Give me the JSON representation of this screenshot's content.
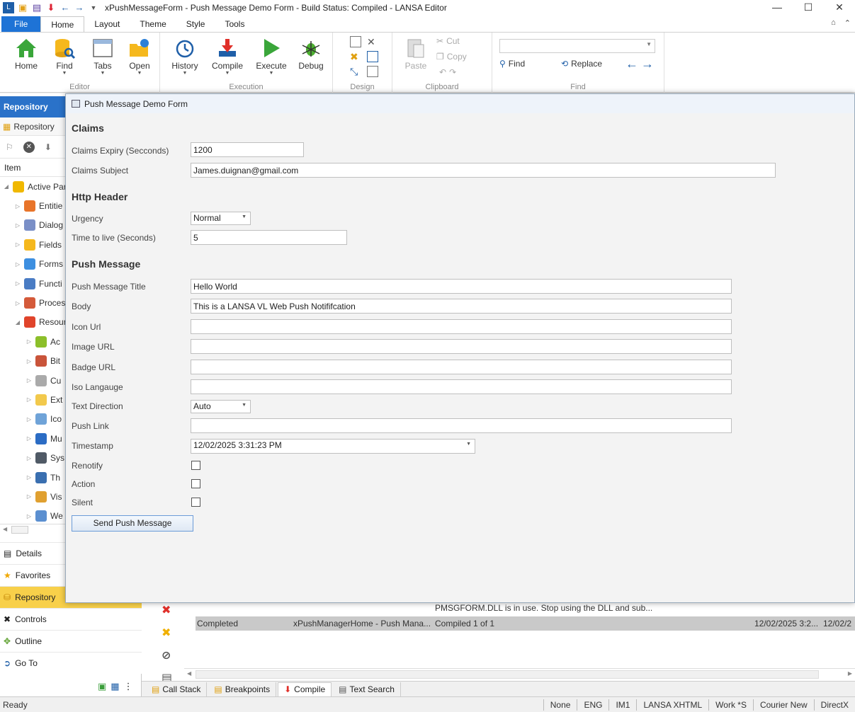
{
  "window": {
    "title": "xPushMessageForm - Push Message Demo Form -   Build Status: Compiled - LANSA Editor",
    "minimize": "—",
    "maximize": "☐",
    "close": "✕"
  },
  "ribbon_tabs": [
    "File",
    "Home",
    "Layout",
    "Theme",
    "Style",
    "Tools"
  ],
  "ribbon": {
    "editor": {
      "label": "Editor",
      "home": "Home",
      "find": "Find",
      "tabs": "Tabs",
      "open": "Open"
    },
    "execution": {
      "label": "Execution",
      "history": "History",
      "compile": "Compile",
      "execute": "Execute",
      "debug": "Debug"
    },
    "design": {
      "label": "Design"
    },
    "clipboard": {
      "label": "Clipboard",
      "paste": "Paste",
      "cut": "Cut",
      "copy": "Copy"
    },
    "find": {
      "label": "Find",
      "find": "Find",
      "replace": "Replace"
    }
  },
  "left_panel": {
    "header": "Repository",
    "tab": "Repository",
    "column": "Item",
    "tree": [
      {
        "label": "Active Par",
        "color": "#f0b800",
        "arrow": "◢",
        "indent": 0
      },
      {
        "label": "Entitie",
        "color": "#e8742a",
        "arrow": "▷",
        "indent": 1
      },
      {
        "label": "Dialog",
        "color": "#7a8fc7",
        "arrow": "▷",
        "indent": 1
      },
      {
        "label": "Fields",
        "color": "#f5b81d",
        "arrow": "▷",
        "indent": 1
      },
      {
        "label": "Forms",
        "color": "#3d8fe0",
        "arrow": "▷",
        "indent": 1
      },
      {
        "label": "Functi",
        "color": "#4a7cc4",
        "arrow": "▷",
        "indent": 1
      },
      {
        "label": "Proces",
        "color": "#d45a3a",
        "arrow": "▷",
        "indent": 1
      },
      {
        "label": "Resour",
        "color": "#e0442b",
        "arrow": "◢",
        "indent": 1
      },
      {
        "label": "Ac",
        "color": "#8cbf2a",
        "arrow": "▷",
        "indent": 2
      },
      {
        "label": "Bit",
        "color": "#c9543a",
        "arrow": "▷",
        "indent": 2
      },
      {
        "label": "Cu",
        "color": "#aaaaaa",
        "arrow": "▷",
        "indent": 2
      },
      {
        "label": "Ext",
        "color": "#f2c94c",
        "arrow": "▷",
        "indent": 2
      },
      {
        "label": "Ico",
        "color": "#6fa3d8",
        "arrow": "▷",
        "indent": 2
      },
      {
        "label": "Mu",
        "color": "#2b6cc4",
        "arrow": "▷",
        "indent": 2
      },
      {
        "label": "Sys",
        "color": "#505a66",
        "arrow": "▷",
        "indent": 2
      },
      {
        "label": "Th",
        "color": "#3a6fb0",
        "arrow": "▷",
        "indent": 2
      },
      {
        "label": "Vis",
        "color": "#e0a030",
        "arrow": "▷",
        "indent": 2
      },
      {
        "label": "We",
        "color": "#5b8fd0",
        "arrow": "▷",
        "indent": 2
      }
    ],
    "sections": [
      "Details",
      "Favorites",
      "Repository",
      "Controls",
      "Outline",
      "Go To"
    ]
  },
  "form": {
    "title": "Push Message Demo Form",
    "claims": {
      "heading": "Claims",
      "expiry_label": "Claims Expiry (Secconds)",
      "expiry_value": "1200",
      "subject_label": "Claims Subject",
      "subject_value": "James.duignan@gmail.com"
    },
    "http": {
      "heading": "Http Header",
      "urgency_label": "Urgency",
      "urgency_value": "Normal",
      "ttl_label": "Time to live (Seconds)",
      "ttl_value": "5"
    },
    "push": {
      "heading": "Push Message",
      "title_label": "Push Message Title",
      "title_value": "Hello World",
      "body_label": "Body",
      "body_value": "This is a LANSA VL Web Push Notififcation",
      "icon_label": "Icon Url",
      "image_label": "Image URL",
      "badge_label": "Badge URL",
      "lang_label": "Iso Langauge",
      "dir_label": "Text Direction",
      "dir_value": "Auto",
      "link_label": "Push Link",
      "timestamp_label": "Timestamp",
      "timestamp_value": "12/02/2025 3:31:23 PM",
      "renotify_label": "Renotify",
      "action_label": "Action",
      "silent_label": "Silent",
      "send_button": "Send Push Message"
    }
  },
  "output": {
    "message": "PMSGFORM.DLL is in use. Stop using the DLL and sub...",
    "row": {
      "status": "Completed",
      "name": "xPushManagerHome - Push Mana...",
      "result": "Compiled 1 of 1",
      "time1": "12/02/2025 3:2...",
      "time2": "12/02/2"
    }
  },
  "bottom_tabs": [
    "Call Stack",
    "Breakpoints",
    "Compile",
    "Text Search"
  ],
  "status": {
    "left": "Ready",
    "cells": [
      "None",
      "ENG",
      "IM1",
      "LANSA XHTML",
      "Work *S",
      "Courier New",
      "DirectX"
    ]
  },
  "colors": {
    "accent": "#1e73d6",
    "repo_header": "#2a72c9",
    "active_section": "#f8d04a"
  }
}
